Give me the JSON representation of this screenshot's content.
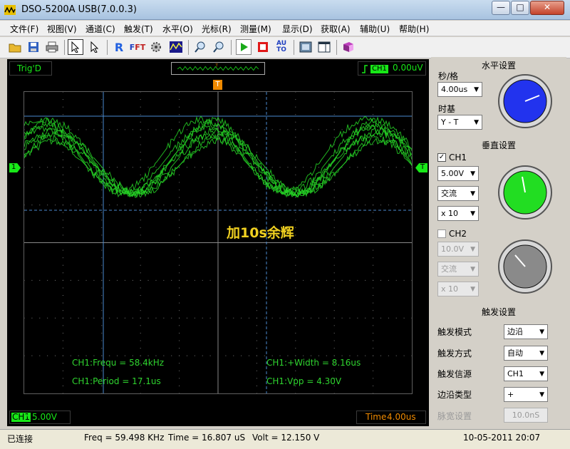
{
  "window": {
    "title": "DSO-5200A USB(7.0.0.3)",
    "minimize": "—",
    "maximize": "□",
    "close": "✕"
  },
  "menu": [
    "文件(F)",
    "视图(V)",
    "通道(C)",
    "触发(T)",
    "水平(O)",
    "光标(R)",
    "测量(M)",
    "显示(D)",
    "获取(A)",
    "辅助(U)",
    "帮助(H)"
  ],
  "toolbar": {
    "icons": [
      "open-folder-icon",
      "save-icon",
      "print-icon",
      "select-arrow-icon",
      "pointer-icon",
      "record-icon",
      "fft-icon",
      "autoset-gear-icon",
      "waveform-icon",
      "zoom-in-icon",
      "zoom-out-icon",
      "run-icon",
      "stop-icon",
      "auto-icon",
      "screenshot-icon",
      "window-icon",
      "book-icon"
    ]
  },
  "scope": {
    "trig_status": "Trig'D",
    "trigger_channel": "CH1",
    "trigger_level": "0.00uV",
    "trigger_marker": "T",
    "ch1_marker": "1",
    "right_trigger_marker": "T",
    "overlay_text": "加10s余辉",
    "readouts": {
      "frequ": "CH1:Frequ = 58.4kHz",
      "period": "CH1:Period = 17.1us",
      "width": "CH1:+Width = 8.16us",
      "vpp": "CH1:Vpp = 4.30V"
    },
    "ch1_status": "CH1",
    "ch1_coupling_symbol": "∿",
    "ch1_volts": "5.00V",
    "time_label": "Time",
    "time_value": "4.00us"
  },
  "horizontal": {
    "title": "水平设置",
    "sec_div_label": "秒/格",
    "sec_div_value": "4.00us",
    "timebase_label": "时基",
    "timebase_value": "Y - T"
  },
  "vertical": {
    "title": "垂直设置",
    "ch1_label": "CH1",
    "ch1_checked": "✓",
    "ch1_volts": "5.00V",
    "ch1_coupling": "交流",
    "ch1_probe": "x 10",
    "ch2_label": "CH2",
    "ch2_volts": "10.0V",
    "ch2_coupling": "交流",
    "ch2_probe": "x 10"
  },
  "trigger": {
    "title": "触发设置",
    "mode_label": "触发模式",
    "mode_value": "边沿",
    "sweep_label": "触发方式",
    "sweep_value": "自动",
    "source_label": "触发信源",
    "source_value": "CH1",
    "slope_label": "边沿类型",
    "slope_value": "+",
    "pulse_label": "脉宽设置",
    "pulse_value": "10.0nS"
  },
  "statusbar": {
    "connection": "已连接",
    "freq": "Freq = 59.498 KHz",
    "time": "Time = 16.807 uS",
    "volt": "Volt = 12.150 V",
    "datetime": "10-05-2011  20:07"
  },
  "colors": {
    "trace": "#26d426",
    "knob_horizontal": "#2233ee",
    "knob_ch1": "#22dd22",
    "knob_ch2": "#8a8a8a",
    "overlay": "#f0d020"
  }
}
